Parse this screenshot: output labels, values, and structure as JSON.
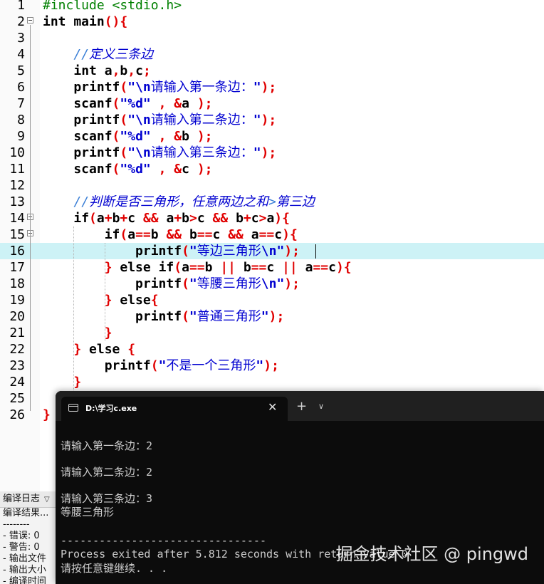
{
  "editor": {
    "current_line": 16,
    "lines": [
      {
        "n": "1",
        "fold": false,
        "tokens": [
          {
            "c": "pp",
            "t": "#include <stdio.h>"
          }
        ]
      },
      {
        "n": "2",
        "fold": true,
        "tokens": [
          {
            "c": "kw",
            "t": "int main"
          },
          {
            "c": "br",
            "t": "(){"
          }
        ]
      },
      {
        "n": "3",
        "fold": false,
        "tokens": []
      },
      {
        "n": "4",
        "fold": false,
        "tokens": [
          {
            "c": "",
            "t": "    "
          },
          {
            "c": "cmt",
            "t": "//"
          },
          {
            "c": "cmt cn",
            "t": "定义三条边"
          }
        ]
      },
      {
        "n": "5",
        "fold": false,
        "tokens": [
          {
            "c": "",
            "t": "    "
          },
          {
            "c": "kw",
            "t": "int "
          },
          {
            "c": "",
            "t": "a"
          },
          {
            "c": "br",
            "t": ","
          },
          {
            "c": "",
            "t": "b"
          },
          {
            "c": "br",
            "t": ","
          },
          {
            "c": "",
            "t": "c"
          },
          {
            "c": "br",
            "t": ";"
          }
        ]
      },
      {
        "n": "6",
        "fold": false,
        "tokens": [
          {
            "c": "",
            "t": "    printf"
          },
          {
            "c": "br",
            "t": "("
          },
          {
            "c": "str",
            "t": "\"\\n"
          },
          {
            "c": "str cn",
            "t": "请输入第一条边："
          },
          {
            "c": "str",
            "t": "\""
          },
          {
            "c": "br",
            "t": ");"
          }
        ]
      },
      {
        "n": "7",
        "fold": false,
        "tokens": [
          {
            "c": "",
            "t": "    scanf"
          },
          {
            "c": "br",
            "t": "("
          },
          {
            "c": "str",
            "t": "\"%d\""
          },
          {
            "c": "",
            "t": " "
          },
          {
            "c": "br",
            "t": ","
          },
          {
            "c": "",
            "t": " "
          },
          {
            "c": "br",
            "t": "&"
          },
          {
            "c": "",
            "t": "a "
          },
          {
            "c": "br",
            "t": ");"
          }
        ]
      },
      {
        "n": "8",
        "fold": false,
        "tokens": [
          {
            "c": "",
            "t": "    printf"
          },
          {
            "c": "br",
            "t": "("
          },
          {
            "c": "str",
            "t": "\"\\n"
          },
          {
            "c": "str cn",
            "t": "请输入第二条边："
          },
          {
            "c": "str",
            "t": "\""
          },
          {
            "c": "br",
            "t": ");"
          }
        ]
      },
      {
        "n": "9",
        "fold": false,
        "tokens": [
          {
            "c": "",
            "t": "    scanf"
          },
          {
            "c": "br",
            "t": "("
          },
          {
            "c": "str",
            "t": "\"%d\""
          },
          {
            "c": "",
            "t": " "
          },
          {
            "c": "br",
            "t": ","
          },
          {
            "c": "",
            "t": " "
          },
          {
            "c": "br",
            "t": "&"
          },
          {
            "c": "",
            "t": "b "
          },
          {
            "c": "br",
            "t": ");"
          }
        ]
      },
      {
        "n": "10",
        "fold": false,
        "tokens": [
          {
            "c": "",
            "t": "    printf"
          },
          {
            "c": "br",
            "t": "("
          },
          {
            "c": "str",
            "t": "\"\\n"
          },
          {
            "c": "str cn",
            "t": "请输入第三条边："
          },
          {
            "c": "str",
            "t": "\""
          },
          {
            "c": "br",
            "t": ");"
          }
        ]
      },
      {
        "n": "11",
        "fold": false,
        "tokens": [
          {
            "c": "",
            "t": "    scanf"
          },
          {
            "c": "br",
            "t": "("
          },
          {
            "c": "str",
            "t": "\"%d\""
          },
          {
            "c": "",
            "t": " "
          },
          {
            "c": "br",
            "t": ","
          },
          {
            "c": "",
            "t": " "
          },
          {
            "c": "br",
            "t": "&"
          },
          {
            "c": "",
            "t": "c "
          },
          {
            "c": "br",
            "t": ");"
          }
        ]
      },
      {
        "n": "12",
        "fold": false,
        "tokens": []
      },
      {
        "n": "13",
        "fold": false,
        "tokens": [
          {
            "c": "",
            "t": "    "
          },
          {
            "c": "cmt",
            "t": "//"
          },
          {
            "c": "cmt cn",
            "t": "判断是否三角形，任意两边之和"
          },
          {
            "c": "cmt",
            "t": ">"
          },
          {
            "c": "cmt cn",
            "t": "第三边"
          }
        ]
      },
      {
        "n": "14",
        "fold": true,
        "tokens": [
          {
            "c": "",
            "t": "    "
          },
          {
            "c": "kw",
            "t": "if"
          },
          {
            "c": "br",
            "t": "("
          },
          {
            "c": "",
            "t": "a"
          },
          {
            "c": "br",
            "t": "+"
          },
          {
            "c": "",
            "t": "b"
          },
          {
            "c": "br",
            "t": "+"
          },
          {
            "c": "",
            "t": "c "
          },
          {
            "c": "br",
            "t": "&&"
          },
          {
            "c": "",
            "t": " a"
          },
          {
            "c": "br",
            "t": "+"
          },
          {
            "c": "",
            "t": "b"
          },
          {
            "c": "br",
            "t": ">"
          },
          {
            "c": "",
            "t": "c "
          },
          {
            "c": "br",
            "t": "&&"
          },
          {
            "c": "",
            "t": " b"
          },
          {
            "c": "br",
            "t": "+"
          },
          {
            "c": "",
            "t": "c"
          },
          {
            "c": "br",
            "t": ">"
          },
          {
            "c": "",
            "t": "a"
          },
          {
            "c": "br",
            "t": "){"
          }
        ]
      },
      {
        "n": "15",
        "fold": true,
        "tokens": [
          {
            "c": "",
            "t": "        "
          },
          {
            "c": "kw",
            "t": "if"
          },
          {
            "c": "br",
            "t": "("
          },
          {
            "c": "",
            "t": "a"
          },
          {
            "c": "br",
            "t": "=="
          },
          {
            "c": "",
            "t": "b "
          },
          {
            "c": "br",
            "t": "&&"
          },
          {
            "c": "",
            "t": " b"
          },
          {
            "c": "br",
            "t": "=="
          },
          {
            "c": "",
            "t": "c "
          },
          {
            "c": "br",
            "t": "&&"
          },
          {
            "c": "",
            "t": " a"
          },
          {
            "c": "br",
            "t": "=="
          },
          {
            "c": "",
            "t": "c"
          },
          {
            "c": "br",
            "t": "){"
          }
        ]
      },
      {
        "n": "16",
        "fold": false,
        "tokens": [
          {
            "c": "",
            "t": "            printf"
          },
          {
            "c": "br",
            "t": "("
          },
          {
            "c": "str",
            "t": "\""
          },
          {
            "c": "str cn",
            "t": "等边三角形"
          },
          {
            "c": "str",
            "t": "\\n\""
          },
          {
            "c": "br",
            "t": ");"
          }
        ]
      },
      {
        "n": "17",
        "fold": false,
        "tokens": [
          {
            "c": "",
            "t": "        "
          },
          {
            "c": "br",
            "t": "}"
          },
          {
            "c": "kw",
            "t": " else if"
          },
          {
            "c": "br",
            "t": "("
          },
          {
            "c": "",
            "t": "a"
          },
          {
            "c": "br",
            "t": "=="
          },
          {
            "c": "",
            "t": "b "
          },
          {
            "c": "br",
            "t": "||"
          },
          {
            "c": "",
            "t": " b"
          },
          {
            "c": "br",
            "t": "=="
          },
          {
            "c": "",
            "t": "c "
          },
          {
            "c": "br",
            "t": "||"
          },
          {
            "c": "",
            "t": " a"
          },
          {
            "c": "br",
            "t": "=="
          },
          {
            "c": "",
            "t": "c"
          },
          {
            "c": "br",
            "t": "){"
          }
        ]
      },
      {
        "n": "18",
        "fold": false,
        "tokens": [
          {
            "c": "",
            "t": "            printf"
          },
          {
            "c": "br",
            "t": "("
          },
          {
            "c": "str",
            "t": "\""
          },
          {
            "c": "str cn",
            "t": "等腰三角形"
          },
          {
            "c": "str",
            "t": "\\n\""
          },
          {
            "c": "br",
            "t": ");"
          }
        ]
      },
      {
        "n": "19",
        "fold": false,
        "tokens": [
          {
            "c": "",
            "t": "        "
          },
          {
            "c": "br",
            "t": "}"
          },
          {
            "c": "kw",
            "t": " else"
          },
          {
            "c": "br",
            "t": "{"
          }
        ]
      },
      {
        "n": "20",
        "fold": false,
        "tokens": [
          {
            "c": "",
            "t": "            printf"
          },
          {
            "c": "br",
            "t": "("
          },
          {
            "c": "str",
            "t": "\""
          },
          {
            "c": "str cn",
            "t": "普通三角形"
          },
          {
            "c": "str",
            "t": "\""
          },
          {
            "c": "br",
            "t": ");"
          }
        ]
      },
      {
        "n": "21",
        "fold": false,
        "tokens": [
          {
            "c": "",
            "t": "        "
          },
          {
            "c": "br",
            "t": "}"
          }
        ]
      },
      {
        "n": "22",
        "fold": false,
        "tokens": [
          {
            "c": "",
            "t": "    "
          },
          {
            "c": "br",
            "t": "}"
          },
          {
            "c": "kw",
            "t": " else "
          },
          {
            "c": "br",
            "t": "{"
          }
        ]
      },
      {
        "n": "23",
        "fold": false,
        "tokens": [
          {
            "c": "",
            "t": "        printf"
          },
          {
            "c": "br",
            "t": "("
          },
          {
            "c": "str",
            "t": "\""
          },
          {
            "c": "str cn",
            "t": "不是一个三角形"
          },
          {
            "c": "str",
            "t": "\""
          },
          {
            "c": "br",
            "t": ");"
          }
        ]
      },
      {
        "n": "24",
        "fold": false,
        "tokens": [
          {
            "c": "",
            "t": "    "
          },
          {
            "c": "br",
            "t": "}"
          }
        ]
      },
      {
        "n": "25",
        "fold": false,
        "tokens": []
      },
      {
        "n": "26",
        "fold": false,
        "tokens": [
          {
            "c": "br",
            "t": "}"
          }
        ]
      }
    ]
  },
  "log": {
    "tab_label": "编译日志",
    "rows": [
      "编译结果...",
      "--------",
      "- 错误: 0",
      "- 警告: 0",
      "- 输出文件",
      "- 输出大小",
      "- 编译时间"
    ]
  },
  "terminal": {
    "tab_title": "D:\\学习c.exe",
    "close_glyph": "✕",
    "new_tab_glyph": "+",
    "dropdown_glyph": "∨",
    "output": [
      "请输入第一条边：2",
      "",
      "请输入第二条边：2",
      "",
      "请输入第三条边：3",
      "等腰三角形",
      "",
      "--------------------------------",
      "Process exited after 5.812 seconds with return value 0",
      "请按任意键继续. . ."
    ]
  },
  "watermark": "掘金技术社区 @ pingwd"
}
